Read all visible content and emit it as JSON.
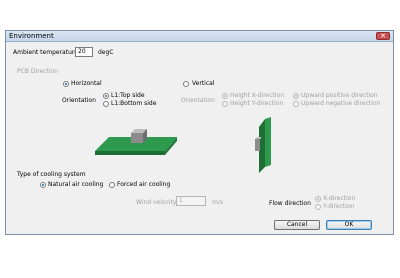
{
  "window": {
    "title": "Environment",
    "close_glyph": "✕"
  },
  "ambient": {
    "label": "Ambient temperature",
    "value": "20",
    "unit": "degC"
  },
  "pcb_direction": {
    "label": "PCB Direction",
    "horizontal_label": "Horizontal",
    "vertical_label": "Vertical",
    "orientation_label": "Orientation",
    "top_side_label": "L1:Top side",
    "bottom_side_label": "L1:Bottom side",
    "v_orientation_label": "Orientation",
    "height_x_label": "Height X-direction",
    "height_y_label": "Height Y-direction",
    "upward_positive_label": "Upward positive direction",
    "upward_negative_label": "Upward negative direction"
  },
  "cooling": {
    "label": "Type of cooling system",
    "natural_label": "Natural air cooling",
    "forced_label": "Forced air cooling",
    "wind_velocity_label": "Wind velocity",
    "wind_velocity_value": "1",
    "wind_unit": "m/s",
    "flow_direction_label": "Flow direction",
    "x_direction_label": "X-direction",
    "y_direction_label": "Y-direction"
  },
  "buttons": {
    "cancel": "Cancel",
    "ok": "OK"
  },
  "colors": {
    "board_top": "#2e9a4e",
    "board_side": "#1e6e36",
    "component": "#8c8c8c"
  }
}
